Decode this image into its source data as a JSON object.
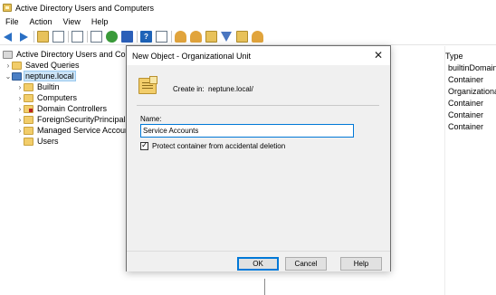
{
  "window": {
    "title": "Active Directory Users and Computers"
  },
  "menu": [
    "File",
    "Action",
    "View",
    "Help"
  ],
  "toolbar": {
    "icons": [
      "back-icon",
      "forward-icon",
      "up-folder-icon",
      "console-tree-icon",
      "copy-icon",
      "properties-icon",
      "refresh-icon",
      "export-icon",
      "help-icon",
      "console-icon",
      "new-user-icon",
      "new-group-icon",
      "new-ou-icon",
      "filter-icon",
      "add-to-group-icon",
      "delegate-icon"
    ]
  },
  "tree": {
    "root_label": "Active Directory Users and Compu",
    "saved_queries": "Saved Queries",
    "domain": "neptune.local",
    "children": [
      "Builtin",
      "Computers",
      "Domain Controllers",
      "ForeignSecurityPrincipals",
      "Managed Service Accounts",
      "Users"
    ]
  },
  "list": {
    "type_header": "Type",
    "types": [
      "builtinDomain",
      "Container",
      "Organizational...",
      "Container",
      "Container",
      "Container"
    ]
  },
  "dialog": {
    "title": "New Object - Organizational Unit",
    "close_glyph": "✕",
    "create_in_label": "Create in:",
    "create_in_value": "neptune.local/",
    "name_label": "Name:",
    "name_value": "Service Accounts",
    "protect_label": "Protect container from accidental deletion",
    "protect_checked": true,
    "ok_label": "OK",
    "cancel_label": "Cancel",
    "help_label": "Help"
  }
}
